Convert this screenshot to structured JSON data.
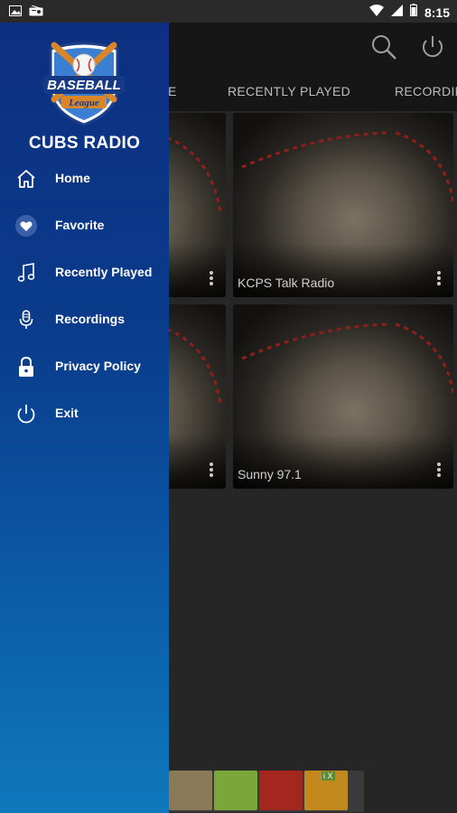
{
  "status_bar": {
    "time": "8:15"
  },
  "app_bar": {
    "tabs": [
      "E",
      "RECENTLY PLAYED",
      "RECORDIN"
    ]
  },
  "drawer": {
    "logo": {
      "word1": "BASEBALL",
      "word2": "League"
    },
    "app_name": "CUBS RADIO",
    "items": [
      {
        "label": "Home",
        "icon": "home-icon"
      },
      {
        "label": "Favorite",
        "icon": "heart-icon"
      },
      {
        "label": "Recently Played",
        "icon": "music-note-icon"
      },
      {
        "label": "Recordings",
        "icon": "microphone-icon"
      },
      {
        "label": "Privacy Policy",
        "icon": "lock-icon"
      },
      {
        "label": "Exit",
        "icon": "power-icon"
      }
    ]
  },
  "stations": [
    {
      "title": ""
    },
    {
      "title": "KCPS Talk Radio"
    },
    {
      "title": ""
    },
    {
      "title": "Sunny 97.1"
    }
  ],
  "ad": {
    "label": "i X"
  },
  "colors": {
    "drawer_top": "#0d2f80",
    "drawer_bottom": "#0e78bb",
    "app_bar": "#161616",
    "background": "#262626"
  }
}
